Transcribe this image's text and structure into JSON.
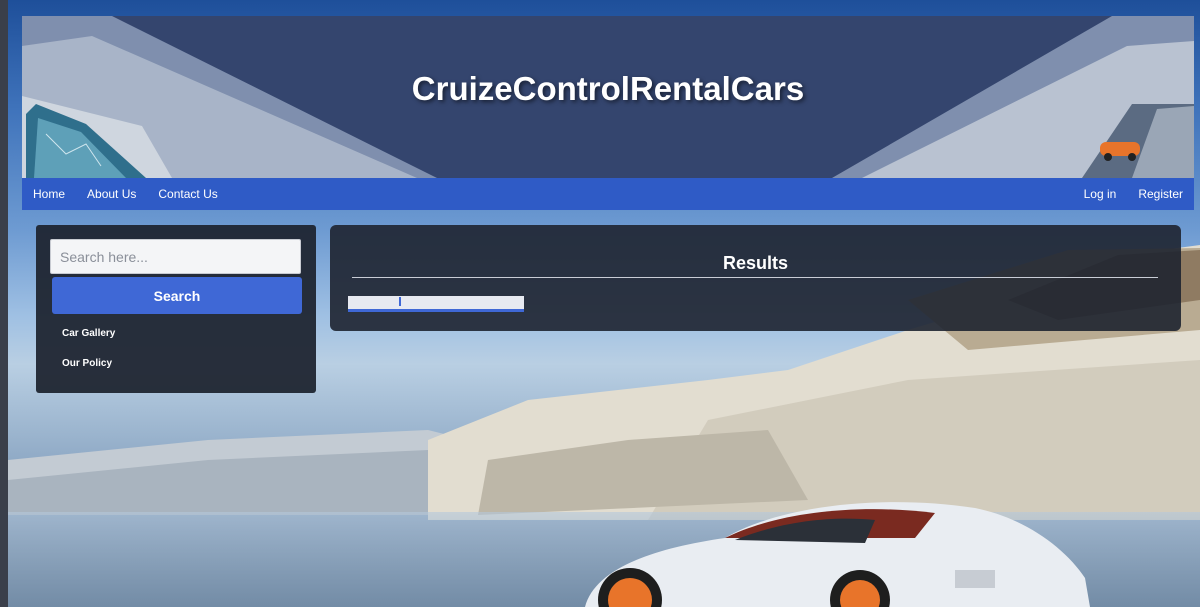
{
  "site": {
    "title": "CruizeControlRentalCars"
  },
  "nav": {
    "left": [
      {
        "label": "Home"
      },
      {
        "label": "About Us"
      },
      {
        "label": "Contact Us"
      }
    ],
    "right": [
      {
        "label": "Log in"
      },
      {
        "label": "Register"
      }
    ]
  },
  "sidebar": {
    "search_placeholder": "Search here...",
    "search_button": "Search",
    "links": [
      {
        "label": "Car Gallery"
      },
      {
        "label": "Our Policy"
      }
    ]
  },
  "results": {
    "title": "Results"
  },
  "colors": {
    "nav_bg": "#2f5bc6",
    "button_bg": "#3f68d6",
    "panel_bg": "#1e2430",
    "header_bg": "#3a4a72",
    "car_accent": "#e8742a"
  },
  "icons": [
    "header-left-car-image",
    "header-right-car-image",
    "background-car-image"
  ]
}
